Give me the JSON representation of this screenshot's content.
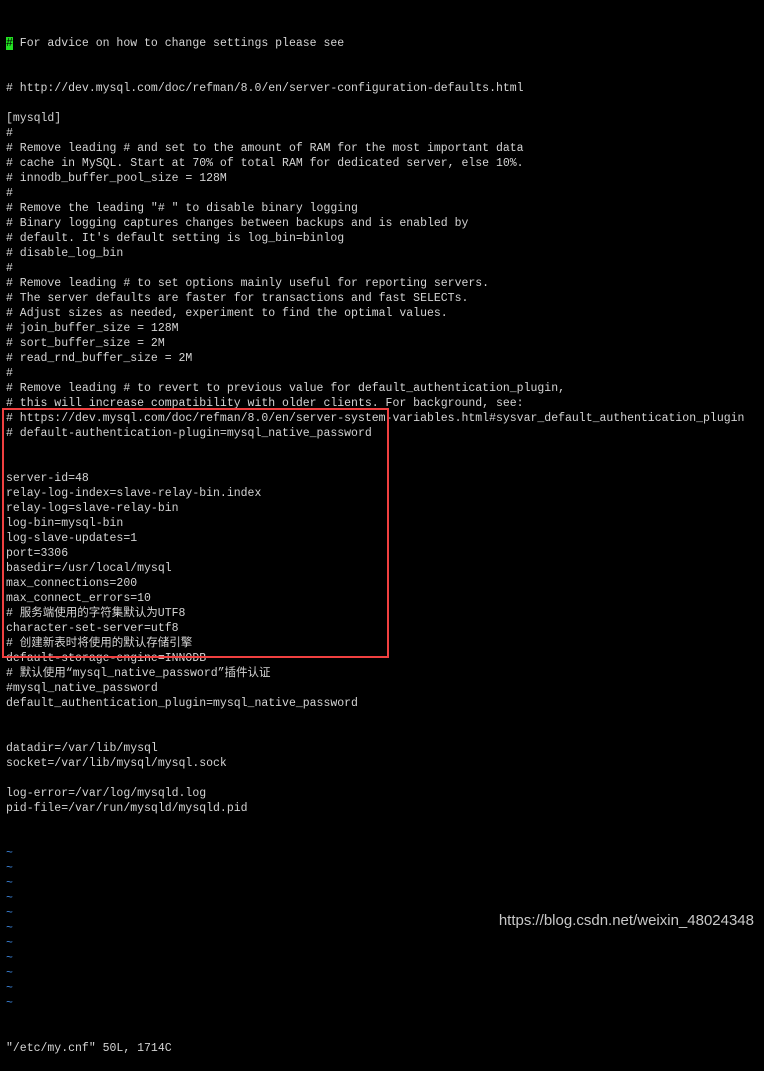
{
  "editor": {
    "cursor_char": "#",
    "first_line_rest": " For advice on how to change settings please see",
    "lines": [
      "# http://dev.mysql.com/doc/refman/8.0/en/server-configuration-defaults.html",
      "",
      "[mysqld]",
      "#",
      "# Remove leading # and set to the amount of RAM for the most important data",
      "# cache in MySQL. Start at 70% of total RAM for dedicated server, else 10%.",
      "# innodb_buffer_pool_size = 128M",
      "#",
      "# Remove the leading \"# \" to disable binary logging",
      "# Binary logging captures changes between backups and is enabled by",
      "# default. It's default setting is log_bin=binlog",
      "# disable_log_bin",
      "#",
      "# Remove leading # to set options mainly useful for reporting servers.",
      "# The server defaults are faster for transactions and fast SELECTs.",
      "# Adjust sizes as needed, experiment to find the optimal values.",
      "# join_buffer_size = 128M",
      "# sort_buffer_size = 2M",
      "# read_rnd_buffer_size = 2M",
      "#",
      "# Remove leading # to revert to previous value for default_authentication_plugin,",
      "# this will increase compatibility with older clients. For background, see:",
      "# https://dev.mysql.com/doc/refman/8.0/en/server-system-variables.html#sysvar_default_authentication_plugin",
      "# default-authentication-plugin=mysql_native_password",
      "",
      "",
      "server-id=48",
      "relay-log-index=slave-relay-bin.index",
      "relay-log=slave-relay-bin",
      "log-bin=mysql-bin",
      "log-slave-updates=1",
      "port=3306",
      "basedir=/usr/local/mysql",
      "max_connections=200",
      "max_connect_errors=10",
      "# 服务端使用的字符集默认为UTF8",
      "character-set-server=utf8",
      "# 创建新表时将使用的默认存储引擎",
      "default-storage-engine=INNODB",
      "# 默认使用“mysql_native_password”插件认证",
      "#mysql_native_password",
      "default_authentication_plugin=mysql_native_password",
      "",
      "",
      "datadir=/var/lib/mysql",
      "socket=/var/lib/mysql/mysql.sock",
      "",
      "log-error=/var/log/mysqld.log",
      "pid-file=/var/run/mysqld/mysqld.pid"
    ],
    "tildes": [
      "~",
      "~",
      "~",
      "~",
      "~",
      "~",
      "~",
      "~",
      "~",
      "~",
      "~"
    ],
    "status": "\"/etc/my.cnf\" 50L, 1714C"
  },
  "watermark": "https://blog.csdn.net/weixin_48024348",
  "colors": {
    "text": "#d4d4d4",
    "tilde": "#3b82d8",
    "cursor": "#22e022",
    "highlight_box": "#f04040"
  }
}
